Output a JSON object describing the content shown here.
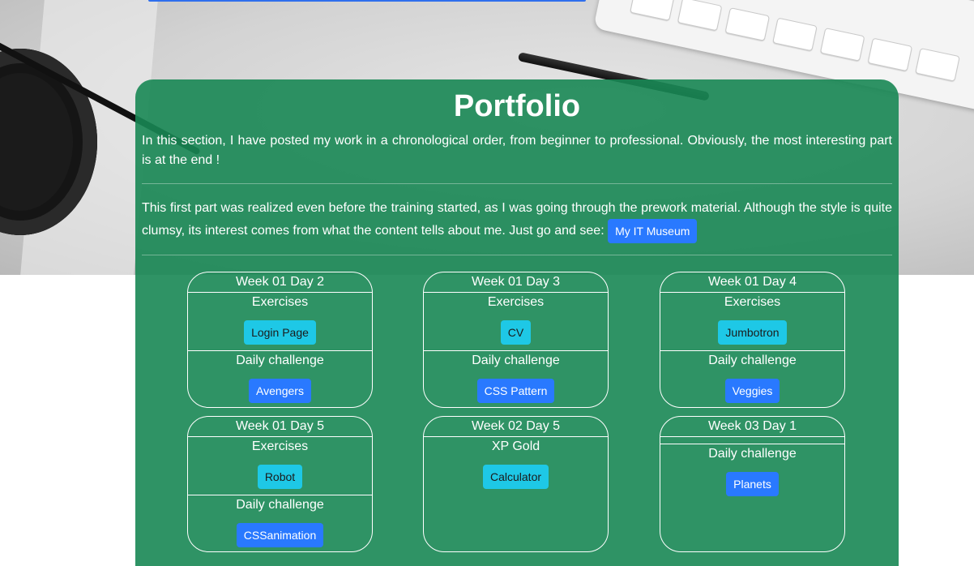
{
  "portfolio": {
    "title": "Portfolio",
    "intro": "In this section, I have posted my work in a chronological order, from beginner to professional. Obviously, the most interesting part is at the end !",
    "museum_text": "This first part was realized even before the training started, as I was going through the prework material. Although the style is quite clumsy, its interest comes from what the content tells about me. Just go and see:",
    "museum_button": "My IT Museum"
  },
  "cards": [
    {
      "title": "Week 01 Day 2",
      "sec1": "Exercises",
      "sec1_button": "Login Page",
      "sec2": "Daily challenge",
      "sec2_button": "Avengers"
    },
    {
      "title": "Week 01 Day 3",
      "sec1": "Exercises",
      "sec1_button": "CV",
      "sec2": "Daily challenge",
      "sec2_button": "CSS Pattern"
    },
    {
      "title": "Week 01 Day 4",
      "sec1": "Exercises",
      "sec1_button": "Jumbotron",
      "sec2": "Daily challenge",
      "sec2_button": "Veggies"
    },
    {
      "title": "Week 01 Day 5",
      "sec1": "Exercises",
      "sec1_button": "Robot",
      "sec2": "Daily challenge",
      "sec2_button": "CSSanimation"
    },
    {
      "title": "Week 02 Day 5",
      "sec1": "XP Gold",
      "sec1_button": "Calculator"
    },
    {
      "title": "Week 03 Day 1",
      "sec2": "Daily challenge",
      "sec2_button": "Planets"
    }
  ],
  "colors": {
    "panel": "#188754",
    "primary": "#2979ff",
    "info": "#1ec8e6"
  }
}
